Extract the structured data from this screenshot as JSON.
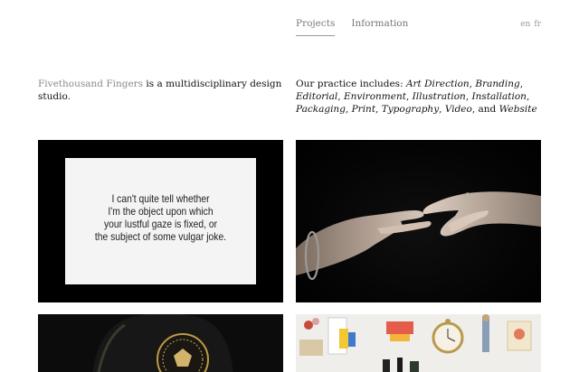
{
  "nav": {
    "projects": "Projects",
    "information": "Information"
  },
  "lang": {
    "en": "en",
    "fr": "fr"
  },
  "intro": {
    "studio_name": "Fivethousand Fingers",
    "text": " is a multidisciplinary design studio."
  },
  "practice": {
    "lead": "Our practice includes: ",
    "items": [
      "Art Direction",
      "Branding",
      "Editorial",
      "Environment",
      "Illustration",
      "Installation",
      "Packaging",
      "Print",
      "Typography",
      "Video"
    ],
    "and_text": ", and ",
    "last": "Website"
  },
  "projects": [
    {
      "card_lines": [
        "I can't quite tell whether",
        "I'm the object upon which",
        "your lustful gaze is fixed, or",
        "the subject of some vulgar joke."
      ]
    }
  ],
  "colors": {
    "studio_name": "#8a8a8a",
    "nav_text": "#777777",
    "tile_dark": "#000000",
    "tile_light": "#f1f1ef"
  }
}
